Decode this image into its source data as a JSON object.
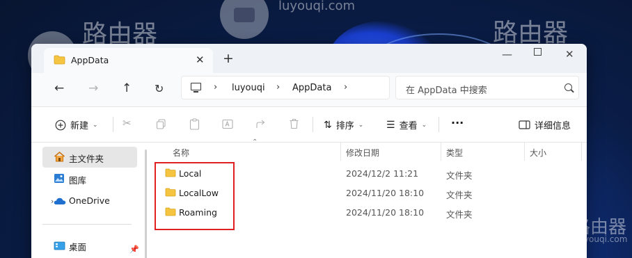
{
  "desktop": {
    "watermark_cn": "路由器",
    "watermark_url": "luyouqi.com",
    "watermark_url_short": "luyouqi.com",
    "watermark_cn_2": "路由器",
    "watermark_cn_3": "路由器"
  },
  "window": {
    "tab_title": "AppData",
    "tab_close": "✕",
    "new_tab": "+",
    "minimize": "—",
    "close": "✕"
  },
  "nav": {
    "back": "←",
    "forward": "→",
    "up": "↑",
    "refresh": "↻",
    "breadcrumb": [
      "luyouqi",
      "AppData"
    ],
    "chevron": "›",
    "search_placeholder": "在 AppData 中搜索"
  },
  "toolbar": {
    "new_label": "新建",
    "sort_label": "排序",
    "view_label": "查看",
    "more_label": "···",
    "details_label": "详细信息"
  },
  "sidebar": {
    "items": [
      {
        "label": "主文件夹",
        "icon": "home-icon"
      },
      {
        "label": "图库",
        "icon": "gallery-icon"
      },
      {
        "label": "OneDrive",
        "icon": "cloud-icon"
      },
      {
        "label": "桌面",
        "icon": "desktop-icon"
      }
    ]
  },
  "columns": {
    "name": "名称",
    "modified": "修改日期",
    "type": "类型",
    "size": "大小"
  },
  "files": [
    {
      "name": "Local",
      "modified": "2024/12/2 11:21",
      "type": "文件夹"
    },
    {
      "name": "LocalLow",
      "modified": "2024/11/20 18:10",
      "type": "文件夹"
    },
    {
      "name": "Roaming",
      "modified": "2024/11/20 18:10",
      "type": "文件夹"
    }
  ],
  "colors": {
    "highlight": "#e02020",
    "folder": "#f5c542",
    "accent": "#0067c0"
  }
}
